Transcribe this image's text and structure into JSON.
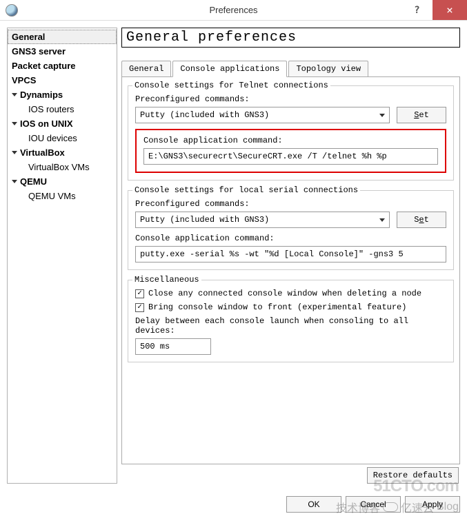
{
  "window": {
    "title": "Preferences"
  },
  "sidebar": {
    "items": [
      {
        "label": "General",
        "bold": true,
        "selected": true,
        "expandable": false,
        "child": false
      },
      {
        "label": "GNS3 server",
        "bold": true,
        "expandable": false,
        "child": false
      },
      {
        "label": "Packet capture",
        "bold": true,
        "expandable": false,
        "child": false
      },
      {
        "label": "VPCS",
        "bold": true,
        "expandable": false,
        "child": false
      },
      {
        "label": "Dynamips",
        "bold": true,
        "expandable": true,
        "child": false
      },
      {
        "label": "IOS routers",
        "bold": false,
        "expandable": false,
        "child": true
      },
      {
        "label": "IOS on UNIX",
        "bold": true,
        "expandable": true,
        "child": false
      },
      {
        "label": "IOU devices",
        "bold": false,
        "expandable": false,
        "child": true
      },
      {
        "label": "VirtualBox",
        "bold": true,
        "expandable": true,
        "child": false
      },
      {
        "label": "VirtualBox VMs",
        "bold": false,
        "expandable": false,
        "child": true
      },
      {
        "label": "QEMU",
        "bold": true,
        "expandable": true,
        "child": false
      },
      {
        "label": "QEMU VMs",
        "bold": false,
        "expandable": false,
        "child": true
      }
    ]
  },
  "main": {
    "page_title": "General preferences",
    "tabs": {
      "general": "General",
      "console_apps": "Console applications",
      "topology_view": "Topology view"
    },
    "telnet_group": {
      "title": "Console settings for Telnet connections",
      "preconf_label": "Preconfigured commands:",
      "preconf_value": "Putty (included with GNS3)",
      "set_btn": "Set",
      "cmd_label": "Console application command:",
      "cmd_value": "E:\\GNS3\\securecrt\\SecureCRT.exe /T /telnet %h %p"
    },
    "serial_group": {
      "title": "Console settings for local serial connections",
      "preconf_label": "Preconfigured commands:",
      "preconf_value": "Putty (included with GNS3)",
      "set_btn": "Set",
      "cmd_label": "Console application command:",
      "cmd_value": "putty.exe -serial %s -wt \"%d [Local Console]\" -gns3 5"
    },
    "misc_group": {
      "title": "Miscellaneous",
      "close_console": "Close any connected console window when deleting a node",
      "bring_front": "Bring console window to front (experimental feature)",
      "delay_label": "Delay between each console launch when consoling to all devices:",
      "delay_value": "500 ms"
    },
    "restore_btn": "Restore defaults"
  },
  "footer": {
    "ok": "OK",
    "cancel": "Cancel",
    "apply": "Apply"
  },
  "watermarks": {
    "w1": "51CTO.com",
    "w2_a": "技术博客",
    "w2_b": "亿速云",
    "w2_c": "Blog"
  }
}
